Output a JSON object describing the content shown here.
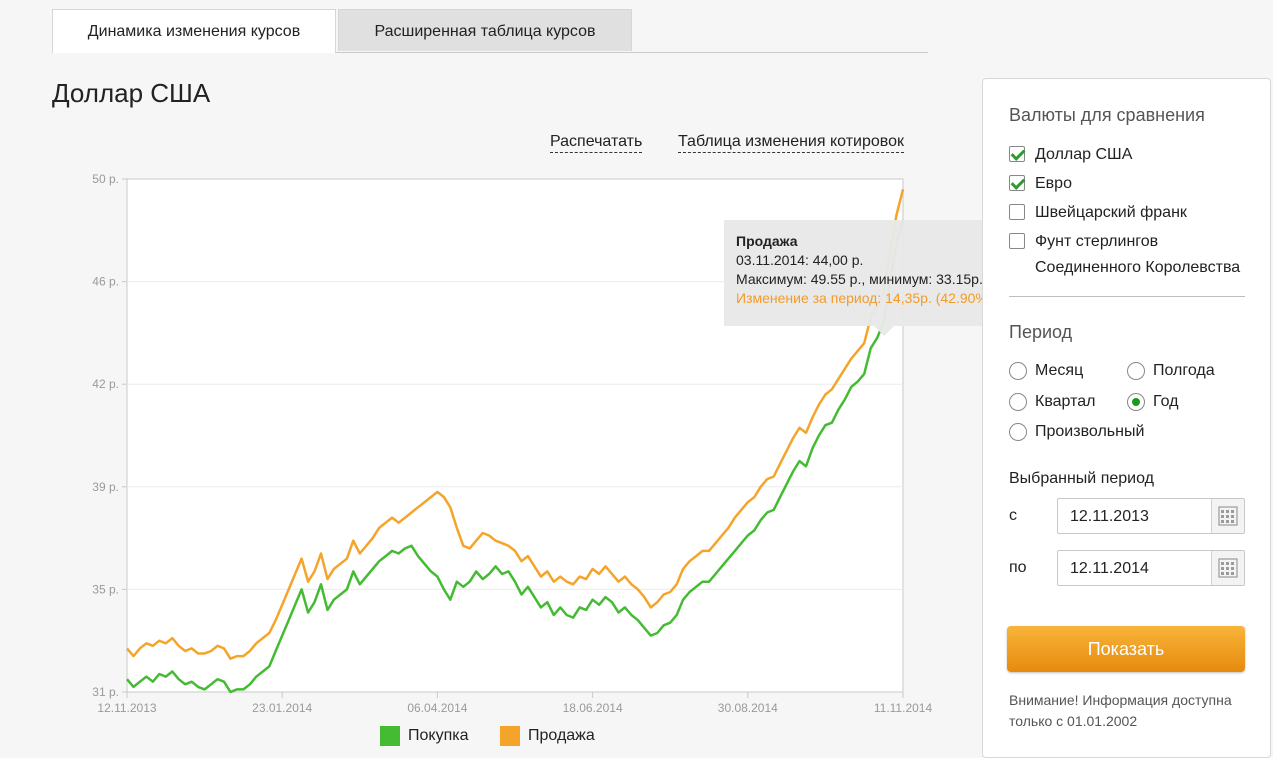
{
  "tabs": [
    {
      "label": "Динамика изменения курсов",
      "active": true
    },
    {
      "label": "Расширенная таблица курсов",
      "active": false
    }
  ],
  "page_title": "Доллар США",
  "links": {
    "print": "Распечатать",
    "quotes_table": "Таблица изменения котировок"
  },
  "tooltip": {
    "title": "Продажа",
    "line1": "03.11.2014: 44,00 р.",
    "line2": "Максимум: 49.55 р., минимум: 33.15р.",
    "change": "Изменение за период: 14,35р. (42.90%)"
  },
  "sidebar": {
    "compare_title": "Валюты для сравнения",
    "currencies": [
      {
        "label": "Доллар США",
        "checked": true
      },
      {
        "label": "Евро",
        "checked": true
      },
      {
        "label": "Швейцарский франк",
        "checked": false
      },
      {
        "label": "Фунт стерлингов Соединенного Королевства",
        "checked": false
      }
    ],
    "period_title": "Период",
    "periods": [
      {
        "label": "Месяц",
        "selected": false
      },
      {
        "label": "Полгода",
        "selected": false
      },
      {
        "label": "Квартал",
        "selected": false
      },
      {
        "label": "Год",
        "selected": true
      },
      {
        "label": "Произвольный",
        "selected": false
      }
    ],
    "selected_period_title": "Выбранный период",
    "from_label": "с",
    "to_label": "по",
    "from_value": "12.11.2013",
    "to_value": "12.11.2014",
    "show_button": "Показать",
    "note": "Внимание! Информация доступна только с 01.01.2002"
  },
  "colors": {
    "buy": "#44bb33",
    "sell": "#f5a42a",
    "accent": "#f0a020"
  },
  "chart_data": {
    "type": "line",
    "x_tick_labels": [
      "12.11.2013",
      "23.01.2014",
      "06.04.2014",
      "18.06.2014",
      "30.08.2014",
      "11.11.2014"
    ],
    "y_tick_labels": [
      "31 р.",
      "35 р.",
      "39 р.",
      "42 р.",
      "46 р.",
      "50 р."
    ],
    "y_tick_values": [
      31,
      35,
      39,
      43,
      47,
      51
    ],
    "ylim": [
      31,
      51
    ],
    "legend": [
      "Покупка",
      "Продажа"
    ],
    "legend_position": "bottom",
    "series": [
      {
        "name": "Покупка",
        "color": "#44bb33",
        "values": [
          31.5,
          31.2,
          31.4,
          31.6,
          31.4,
          31.7,
          31.6,
          31.8,
          31.5,
          31.3,
          31.4,
          31.2,
          31.1,
          31.3,
          31.5,
          31.4,
          31.0,
          31.1,
          31.1,
          31.3,
          31.6,
          31.8,
          32.0,
          32.6,
          33.2,
          33.8,
          34.4,
          35.0,
          34.1,
          34.5,
          35.2,
          34.2,
          34.6,
          34.8,
          35.0,
          35.7,
          35.2,
          35.5,
          35.8,
          36.1,
          36.3,
          36.5,
          36.4,
          36.6,
          36.7,
          36.3,
          36.0,
          35.7,
          35.5,
          35.0,
          34.6,
          35.3,
          35.1,
          35.3,
          35.7,
          35.4,
          35.6,
          35.9,
          35.6,
          35.7,
          35.3,
          34.8,
          35.1,
          34.7,
          34.3,
          34.5,
          34.0,
          34.3,
          34.0,
          33.9,
          34.3,
          34.2,
          34.6,
          34.4,
          34.7,
          34.5,
          34.1,
          34.3,
          34.0,
          33.8,
          33.5,
          33.2,
          33.3,
          33.6,
          33.7,
          34.0,
          34.6,
          34.9,
          35.1,
          35.3,
          35.3,
          35.6,
          35.9,
          36.2,
          36.5,
          36.8,
          37.1,
          37.3,
          37.7,
          38.0,
          38.1,
          38.6,
          39.1,
          39.6,
          40.0,
          39.8,
          40.5,
          41.0,
          41.4,
          41.5,
          42.0,
          42.4,
          42.9,
          43.1,
          43.4,
          44.4,
          44.8,
          45.4,
          47.0,
          48.5,
          49.4
        ]
      },
      {
        "name": "Продажа",
        "color": "#f5a42a",
        "values": [
          32.7,
          32.4,
          32.7,
          32.9,
          32.8,
          33.0,
          32.9,
          33.1,
          32.8,
          32.6,
          32.7,
          32.5,
          32.5,
          32.6,
          32.8,
          32.7,
          32.3,
          32.4,
          32.4,
          32.6,
          32.9,
          33.1,
          33.3,
          33.8,
          34.4,
          35.0,
          35.6,
          36.2,
          35.3,
          35.7,
          36.4,
          35.4,
          35.8,
          36.0,
          36.2,
          36.9,
          36.4,
          36.7,
          37.0,
          37.4,
          37.6,
          37.8,
          37.6,
          37.8,
          38.0,
          38.2,
          38.4,
          38.6,
          38.8,
          38.6,
          38.2,
          37.4,
          36.7,
          36.6,
          36.9,
          37.2,
          37.1,
          36.9,
          36.8,
          36.7,
          36.5,
          36.1,
          36.3,
          35.9,
          35.5,
          35.7,
          35.3,
          35.5,
          35.3,
          35.2,
          35.5,
          35.4,
          35.8,
          35.6,
          35.9,
          35.6,
          35.3,
          35.5,
          35.2,
          35.0,
          34.7,
          34.3,
          34.5,
          34.8,
          34.9,
          35.2,
          35.8,
          36.1,
          36.3,
          36.5,
          36.5,
          36.8,
          37.1,
          37.4,
          37.8,
          38.1,
          38.4,
          38.6,
          39.0,
          39.3,
          39.4,
          39.9,
          40.4,
          40.9,
          41.3,
          41.1,
          41.7,
          42.2,
          42.6,
          42.8,
          43.2,
          43.6,
          44.0,
          44.3,
          44.6,
          45.6,
          46.0,
          46.6,
          48.2,
          49.6,
          50.6
        ]
      }
    ]
  }
}
